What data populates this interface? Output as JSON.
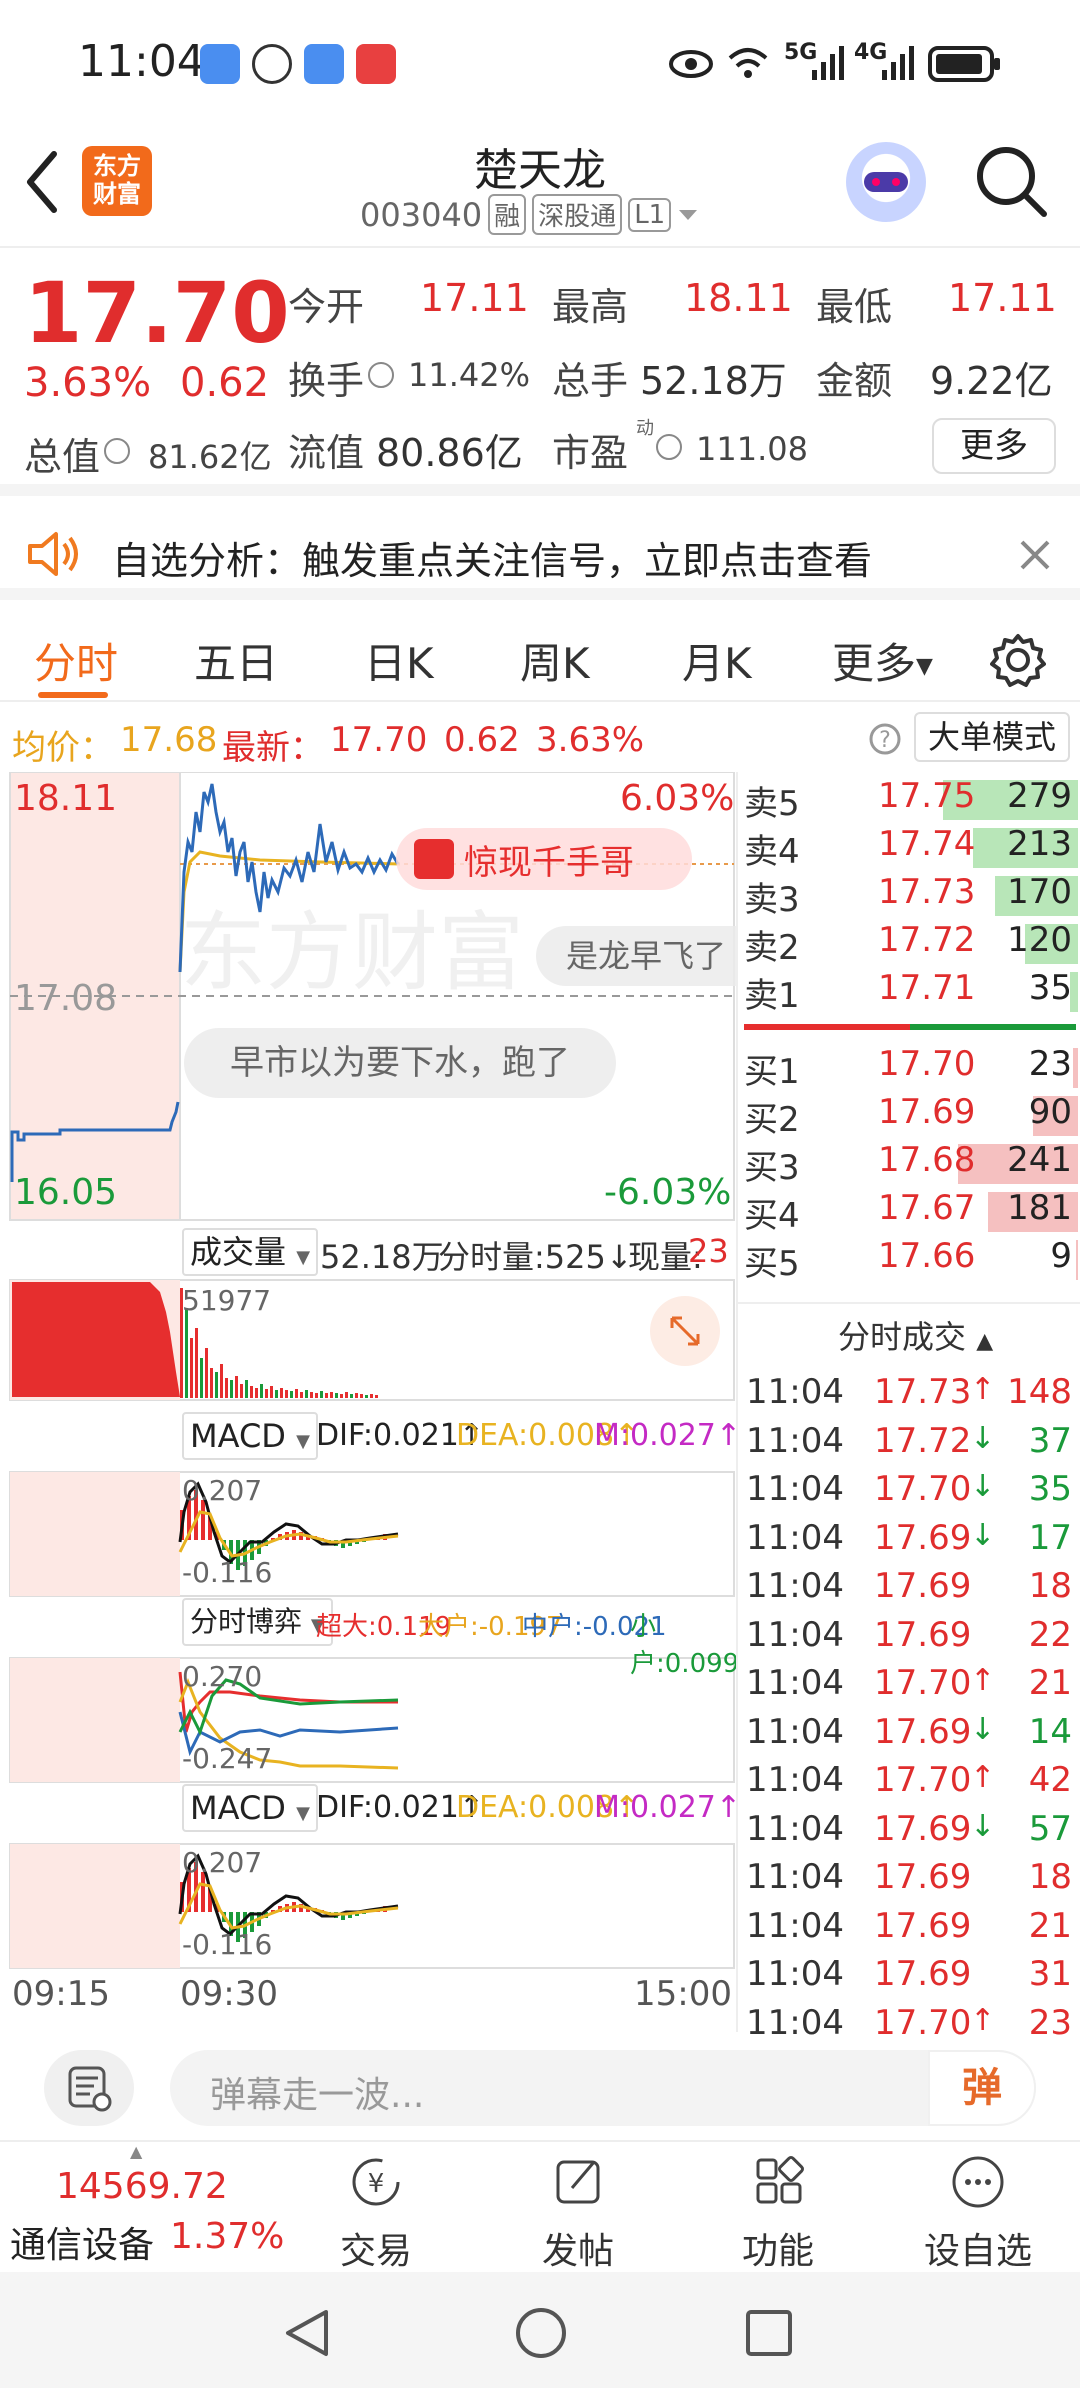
{
  "status_bar": {
    "time": "11:04",
    "network": [
      "5G",
      "4G"
    ]
  },
  "header": {
    "app_logo": "东方\n财富",
    "title": "楚天龙",
    "code": "003040",
    "tags": [
      "融",
      "深股通",
      "L1"
    ]
  },
  "quote": {
    "price": "17.70",
    "change_pct": "3.63%",
    "change": "0.62",
    "open_label": "今开",
    "open": "17.11",
    "high_label": "最高",
    "high": "18.11",
    "low_label": "最低",
    "low": "17.11",
    "turnover_label": "换手",
    "turnover": "11.42%",
    "volume_label": "总手",
    "volume": "52.18万",
    "amount_label": "金额",
    "amount": "9.22亿",
    "mktcap_label": "总值",
    "mktcap": "81.62亿",
    "float_label": "流值",
    "float_cap": "80.86亿",
    "pe_label": "市盈",
    "pe_sup": "动",
    "pe": "111.08",
    "more_label": "更多"
  },
  "notice": {
    "text": "自选分析：触发重点关注信号，立即点击查看"
  },
  "tabs": [
    "分时",
    "五日",
    "日K",
    "周K",
    "月K",
    "更多"
  ],
  "info_row": {
    "avg_label": "均价：",
    "avg": "17.68",
    "latest_label": "最新：",
    "latest": "17.70",
    "change": "0.62",
    "change_pct": "3.63%",
    "mode_label": "大单模式"
  },
  "chart": {
    "y_high": "18.11",
    "y_mid": "17.08",
    "y_low": "16.05",
    "pct_high": "6.03%",
    "pct_low": "-6.03%",
    "danmu_1": "惊现千手哥",
    "danmu_2": "是龙早飞了",
    "danmu_3": "早市以为要下水，跑了",
    "watermark": "东方财富",
    "vol_label": "成交量",
    "vol_total": "52.18万",
    "vol_tick_label": "分时量:525↓",
    "vol_now_label": "现量:",
    "vol_now": "23",
    "vol_axis": "51977",
    "macd_label": "MACD",
    "dif": "DIF:0.021↑",
    "dea": "DEA:0.008↑",
    "m": "M:0.027↑",
    "macd_top": "0.207",
    "macd_bot": "-0.116",
    "game_label": "分时博弈",
    "super": "超大:0.119",
    "big": "大户:-0.197",
    "mid": "中户:-0.021",
    "small": "小户:0.099",
    "game_top": "0.270",
    "game_bot": "-0.247",
    "time_start": "09:15",
    "time_open": "09:30",
    "time_end": "15:00"
  },
  "order_book": {
    "asks": [
      {
        "label": "卖5",
        "price": "17.75",
        "vol": "279",
        "level": 0.9
      },
      {
        "label": "卖4",
        "price": "17.74",
        "vol": "213",
        "level": 0.7
      },
      {
        "label": "卖3",
        "price": "17.73",
        "vol": "170",
        "level": 0.55
      },
      {
        "label": "卖2",
        "price": "17.72",
        "vol": "120",
        "level": 0.35
      },
      {
        "label": "卖1",
        "price": "17.71",
        "vol": "35",
        "level": 0.05
      }
    ],
    "bids": [
      {
        "label": "买1",
        "price": "17.70",
        "vol": "23",
        "level": 0.03
      },
      {
        "label": "买2",
        "price": "17.69",
        "vol": "90",
        "level": 0.3
      },
      {
        "label": "买3",
        "price": "17.68",
        "vol": "241",
        "level": 0.8
      },
      {
        "label": "买4",
        "price": "17.67",
        "vol": "181",
        "level": 0.6
      },
      {
        "label": "买5",
        "price": "17.66",
        "vol": "9",
        "level": 0.01
      }
    ],
    "trades_header": "分时成交",
    "trades": [
      {
        "time": "11:04",
        "price": "17.73",
        "dir": "↑",
        "vol": "148"
      },
      {
        "time": "11:04",
        "price": "17.72",
        "dir": "↓",
        "vol": "37"
      },
      {
        "time": "11:04",
        "price": "17.70",
        "dir": "↓",
        "vol": "35"
      },
      {
        "time": "11:04",
        "price": "17.69",
        "dir": "↓",
        "vol": "17"
      },
      {
        "time": "11:04",
        "price": "17.69",
        "dir": "",
        "vol": "18"
      },
      {
        "time": "11:04",
        "price": "17.69",
        "dir": "",
        "vol": "22"
      },
      {
        "time": "11:04",
        "price": "17.70",
        "dir": "↑",
        "vol": "21"
      },
      {
        "time": "11:04",
        "price": "17.69",
        "dir": "↓",
        "vol": "14"
      },
      {
        "time": "11:04",
        "price": "17.70",
        "dir": "↑",
        "vol": "42"
      },
      {
        "time": "11:04",
        "price": "17.69",
        "dir": "↓",
        "vol": "57"
      },
      {
        "time": "11:04",
        "price": "17.69",
        "dir": "",
        "vol": "18"
      },
      {
        "time": "11:04",
        "price": "17.69",
        "dir": "",
        "vol": "21"
      },
      {
        "time": "11:04",
        "price": "17.69",
        "dir": "",
        "vol": "31"
      },
      {
        "time": "11:04",
        "price": "17.70",
        "dir": "↑",
        "vol": "23"
      }
    ]
  },
  "danmu_bar": {
    "placeholder": "弹幕走一波...",
    "btn": "弹"
  },
  "bottom_nav": {
    "index_value": "14569.72",
    "index_name": "通信设备",
    "index_pct": "1.37%",
    "items": [
      "交易",
      "发帖",
      "功能",
      "设自选"
    ]
  },
  "colors": {
    "up": "#e02d2d",
    "down": "#1a9a3a",
    "accent": "#ff6a1a",
    "avg_line": "#e8b321",
    "price_line": "#2d6ab8"
  }
}
